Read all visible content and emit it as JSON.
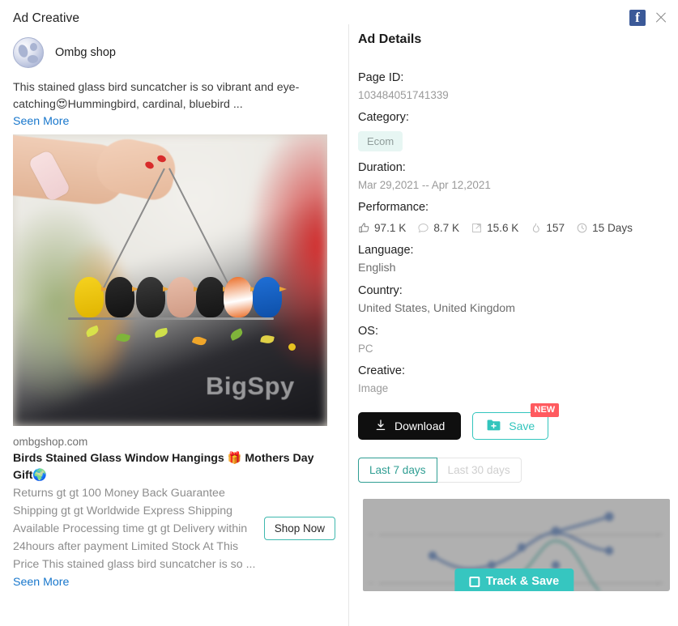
{
  "header": {
    "left_title": "Ad Creative",
    "facebook_icon": "facebook-icon",
    "close_icon": "close-icon"
  },
  "creative": {
    "advertiser_name": "Ombg shop",
    "avatar_icon": "globe-avatar-icon",
    "primary_text": "This stained glass bird suncatcher is so vibrant and eye-catching😍Hummingbird, cardinal, bluebird ...",
    "seen_more_label": "Seen More",
    "image_watermark": "BigSpy",
    "link_domain": "ombgshop.com",
    "link_title": "Birds Stained Glass Window Hangings 🎁 Mothers Day Gift🌍",
    "link_description": "Returns gt gt 100 Money Back Guarantee Shipping gt gt Worldwide Express Shipping Available Processing time gt gt Delivery within 24hours after payment Limited Stock At This Price This stained glass bird suncatcher is so",
    "description_ellipsis": "...",
    "description_seen_more": "Seen More",
    "cta_label": "Shop Now"
  },
  "details": {
    "title": "Ad Details",
    "page_id_label": "Page ID:",
    "page_id_value": "103484051741339",
    "category_label": "Category:",
    "category_value": "Ecom",
    "duration_label": "Duration:",
    "duration_value": "Mar 29,2021 -- Apr 12,2021",
    "performance_label": "Performance:",
    "performance": [
      {
        "icon": "thumbs-up-icon",
        "value": "97.1 K"
      },
      {
        "icon": "comment-icon",
        "value": "8.7 K"
      },
      {
        "icon": "share-icon",
        "value": "15.6 K"
      },
      {
        "icon": "flame-icon",
        "value": "157"
      },
      {
        "icon": "clock-icon",
        "value": "15 Days"
      }
    ],
    "language_label": "Language:",
    "language_value": "English",
    "country_label": "Country:",
    "country_value": "United States, United Kingdom",
    "os_label": "OS:",
    "os_value": "PC",
    "creative_label": "Creative:",
    "creative_value": "Image",
    "download_label": "Download",
    "download_icon": "download-icon",
    "save_label": "Save",
    "save_icon": "folder-plus-icon",
    "new_badge": "NEW",
    "tabs": [
      {
        "label": "Last 7 days",
        "active": true
      },
      {
        "label": "Last 30 days",
        "active": false
      }
    ],
    "track_label": "Track & Save",
    "track_icon": "checkbox-icon"
  },
  "chart_data": {
    "type": "line",
    "title": "",
    "xlabel": "",
    "ylabel": "",
    "grid": true,
    "legend": "none",
    "locked": true,
    "series": [
      {
        "name": "Series 1",
        "color": "#2f64b8",
        "values": [
          34,
          22,
          50,
          72,
          76,
          88
        ]
      },
      {
        "name": "Series 2",
        "color": "#2f64b8",
        "values": [
          34,
          22,
          50,
          72,
          30,
          42
        ]
      },
      {
        "name": "Series 3",
        "color": "#46b8ae",
        "values": [
          2,
          5,
          14,
          40,
          72,
          18
        ]
      }
    ],
    "x": [
      1,
      2,
      3,
      4,
      5,
      6
    ],
    "ylim": [
      0,
      100
    ]
  },
  "colors": {
    "accent_teal": "#32c5bd",
    "link_blue": "#1877cc",
    "badge_red": "#ff5a5f",
    "facebook_blue": "#3b5998",
    "chip_bg": "#e7f6f3",
    "download_black": "#0f0f0f"
  }
}
